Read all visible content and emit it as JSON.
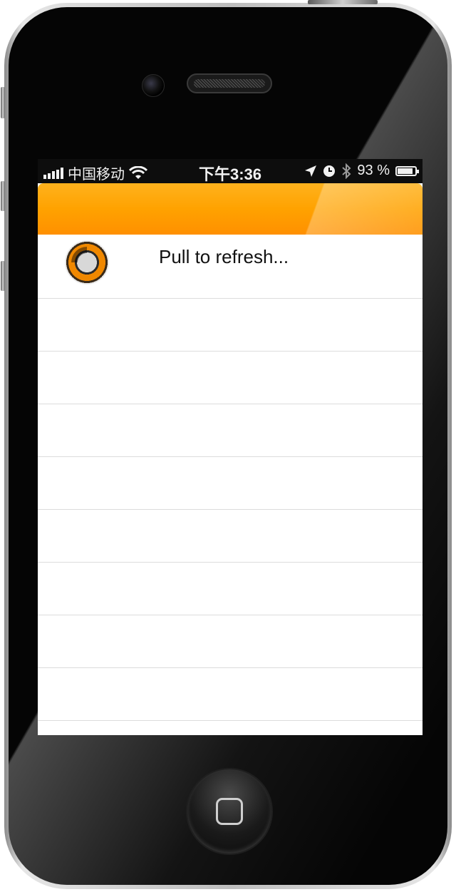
{
  "status_bar": {
    "carrier": "中国移动",
    "time": "下午3:36",
    "battery_percent": "93 %",
    "icons": [
      "signal-icon",
      "wifi-icon",
      "location-arrow-icon",
      "alarm-clock-icon",
      "bluetooth-icon",
      "battery-charging-icon"
    ]
  },
  "nav_bar": {
    "color": "#ffa200"
  },
  "refresh_header": {
    "label": "Pull to refresh...",
    "icon": "refresh-spinner-icon"
  },
  "empty_rows": 8,
  "colors": {
    "accent": "#ffa200",
    "separator": "#dcdcdc"
  }
}
